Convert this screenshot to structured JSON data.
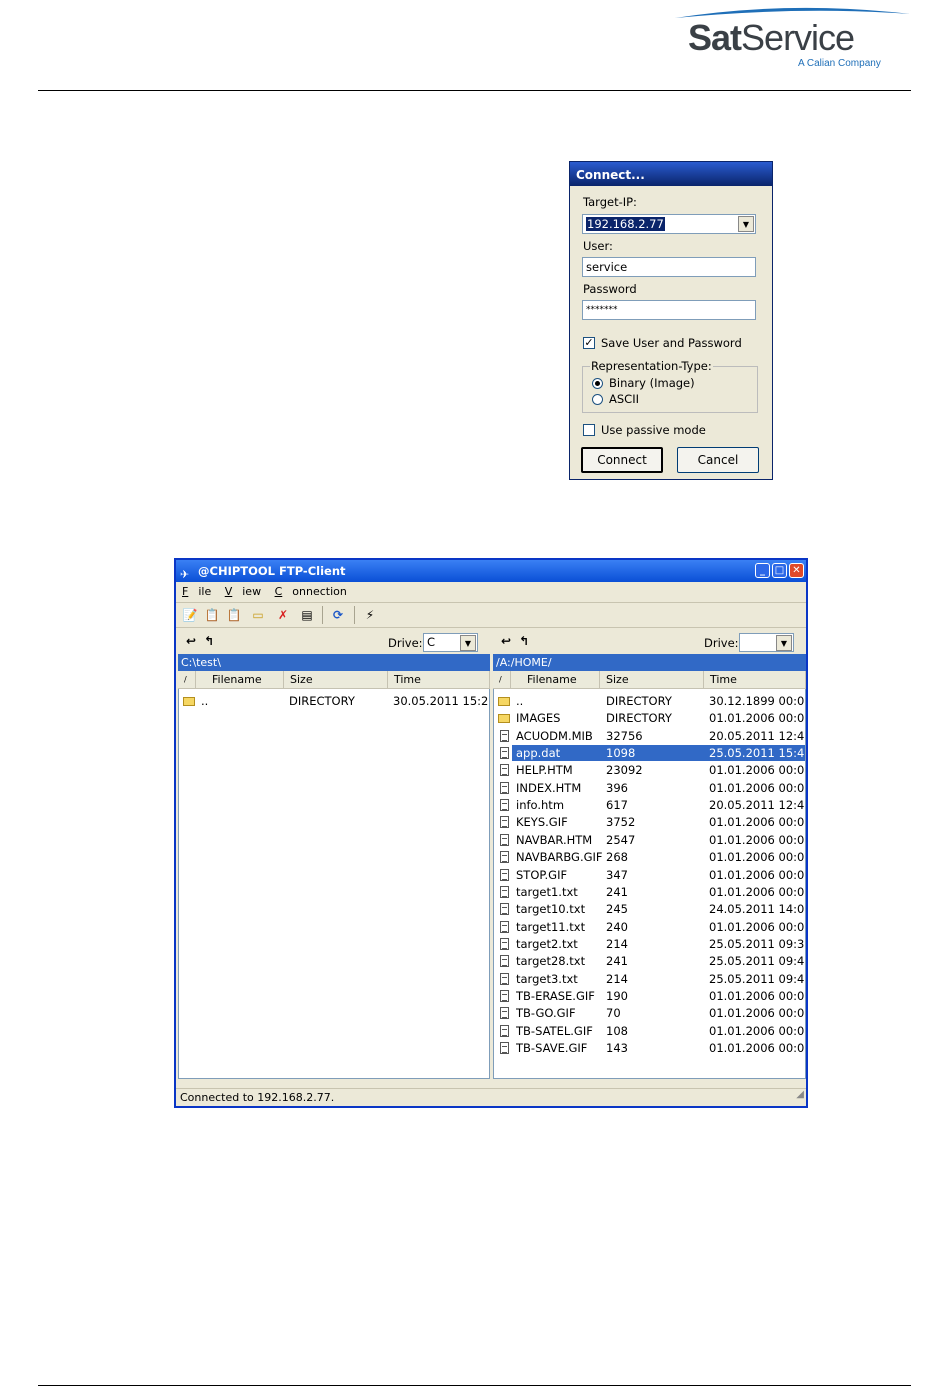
{
  "header": {
    "logo_sat": "Sat",
    "logo_service": "Service",
    "logo_tagline": "A Calian Company",
    "colors": {
      "arc": "#1f6fb8",
      "wordmark": "#3a4046"
    }
  },
  "connect_dialog": {
    "title": "Connect...",
    "target_ip_label": "Target-IP:",
    "target_ip_value": "192.168.2.77",
    "user_label": "User:",
    "user_value": "service",
    "password_label": "Password",
    "password_value": "*******",
    "save_checkbox_label": "Save User and Password",
    "save_checked": true,
    "representation_title": "Representation-Type:",
    "radio_binary": "Binary (Image)",
    "radio_ascii": "ASCII",
    "binary_selected": true,
    "passive_label": "Use passive mode",
    "passive_checked": false,
    "connect_button": "Connect",
    "cancel_button": "Cancel"
  },
  "ftp_window": {
    "title": "@CHIPTOOL FTP-Client",
    "menu": {
      "file": "File",
      "view": "View",
      "connection": "Connection"
    },
    "drive_label": "Drive:",
    "local": {
      "drive_value": "C",
      "path": "C:\\test\\",
      "columns": {
        "sort": "/",
        "filename": "Filename",
        "size": "Size",
        "time": "Time"
      },
      "rows": [
        {
          "name": "..",
          "size": "DIRECTORY",
          "time": "30.05.2011 15:2...",
          "type": "folder"
        }
      ]
    },
    "remote": {
      "drive_value": "",
      "path": "/A:/HOME/",
      "columns": {
        "sort": "/",
        "filename": "Filename",
        "size": "Size",
        "time": "Time"
      },
      "rows": [
        {
          "name": "..",
          "size": "DIRECTORY",
          "time": "30.12.1899 00:0...",
          "type": "folder"
        },
        {
          "name": "IMAGES",
          "size": "DIRECTORY",
          "time": "01.01.2006 00:0...",
          "type": "folder"
        },
        {
          "name": "ACUODM.MIB",
          "size": "32756",
          "time": "20.05.2011 12:4...",
          "type": "file"
        },
        {
          "name": "app.dat",
          "size": "1098",
          "time": "25.05.2011 15:4...",
          "type": "file",
          "selected": true
        },
        {
          "name": "HELP.HTM",
          "size": "23092",
          "time": "01.01.2006 00:0...",
          "type": "file"
        },
        {
          "name": "INDEX.HTM",
          "size": "396",
          "time": "01.01.2006 00:0...",
          "type": "file"
        },
        {
          "name": "info.htm",
          "size": "617",
          "time": "20.05.2011 12:4...",
          "type": "file"
        },
        {
          "name": "KEYS.GIF",
          "size": "3752",
          "time": "01.01.2006 00:0...",
          "type": "file"
        },
        {
          "name": "NAVBAR.HTM",
          "size": "2547",
          "time": "01.01.2006 00:0...",
          "type": "file"
        },
        {
          "name": "NAVBARBG.GIF",
          "size": "268",
          "time": "01.01.2006 00:0...",
          "type": "file"
        },
        {
          "name": "STOP.GIF",
          "size": "347",
          "time": "01.01.2006 00:0...",
          "type": "file"
        },
        {
          "name": "target1.txt",
          "size": "241",
          "time": "01.01.2006 00:0...",
          "type": "file"
        },
        {
          "name": "target10.txt",
          "size": "245",
          "time": "24.05.2011 14:0...",
          "type": "file"
        },
        {
          "name": "target11.txt",
          "size": "240",
          "time": "01.01.2006 00:0...",
          "type": "file"
        },
        {
          "name": "target2.txt",
          "size": "214",
          "time": "25.05.2011 09:3...",
          "type": "file"
        },
        {
          "name": "target28.txt",
          "size": "241",
          "time": "25.05.2011 09:4...",
          "type": "file"
        },
        {
          "name": "target3.txt",
          "size": "214",
          "time": "25.05.2011 09:4...",
          "type": "file"
        },
        {
          "name": "TB-ERASE.GIF",
          "size": "190",
          "time": "01.01.2006 00:0...",
          "type": "file"
        },
        {
          "name": "TB-GO.GIF",
          "size": "70",
          "time": "01.01.2006 00:0...",
          "type": "file"
        },
        {
          "name": "TB-SATEL.GIF",
          "size": "108",
          "time": "01.01.2006 00:0...",
          "type": "file"
        },
        {
          "name": "TB-SAVE.GIF",
          "size": "143",
          "time": "01.01.2006 00:0...",
          "type": "file"
        }
      ]
    },
    "status_text": "Connected to 192.168.2.77.",
    "toolbar_icons": [
      "new-file-icon",
      "copy-icon",
      "paste-icon",
      "new-folder-icon",
      "delete-icon",
      "properties-icon",
      "refresh-icon",
      "disconnect-icon"
    ],
    "colors": {
      "title_bar": "#0a4fd6",
      "selection": "#3169c6"
    }
  }
}
